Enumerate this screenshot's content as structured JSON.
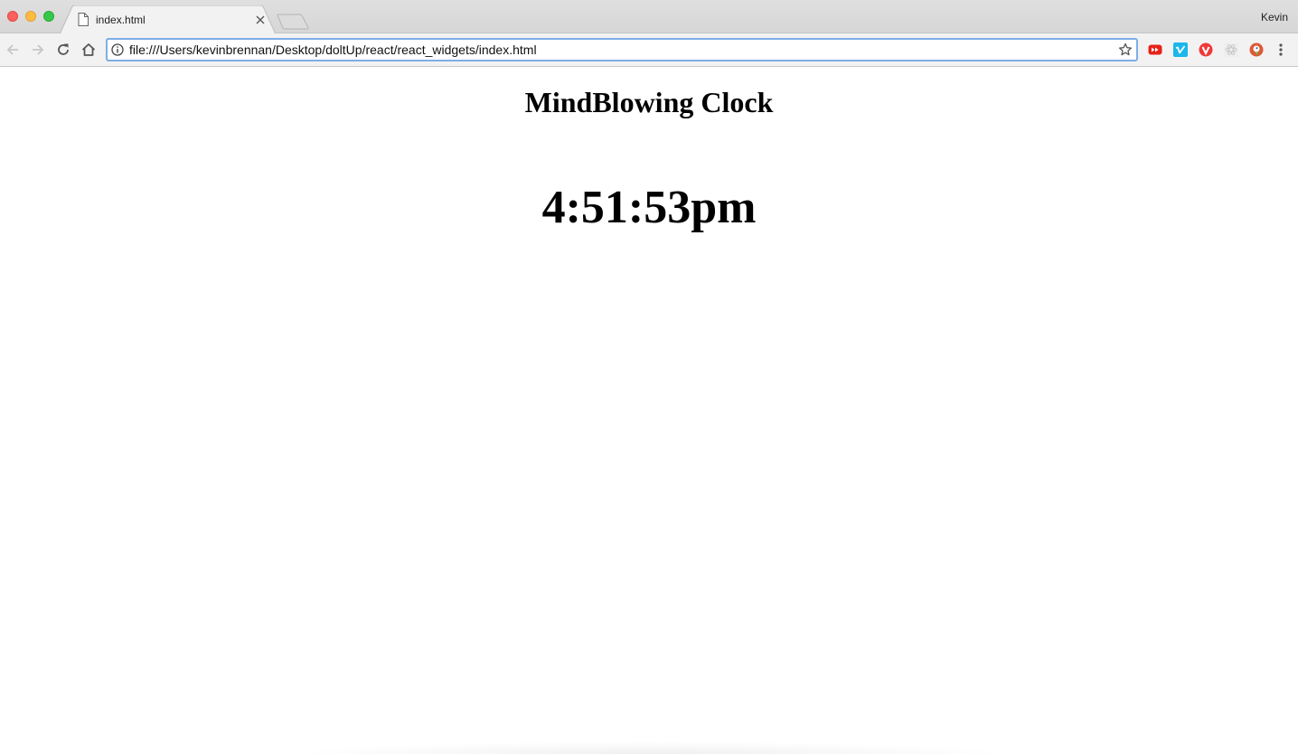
{
  "browser": {
    "tab": {
      "title": "index.html"
    },
    "profile_name": "Kevin",
    "address_bar": {
      "url": "file:///Users/kevinbrennan/Desktop/doltUp/react/react_widgets/index.html"
    },
    "extensions": [
      {
        "icon": "youtube-icon",
        "color": "#e62117"
      },
      {
        "icon": "vimeo-icon",
        "color": "#1ab7ea"
      },
      {
        "icon": "vivaldi-shield-icon",
        "color": "#ef3939"
      },
      {
        "icon": "react-devtools-icon",
        "color": "#cccccc"
      },
      {
        "icon": "duckduckgo-icon",
        "color": "#de5833"
      }
    ],
    "accent_color": "#7eaee6"
  },
  "page": {
    "heading": "MindBlowing Clock",
    "time": "4:51:53pm"
  }
}
